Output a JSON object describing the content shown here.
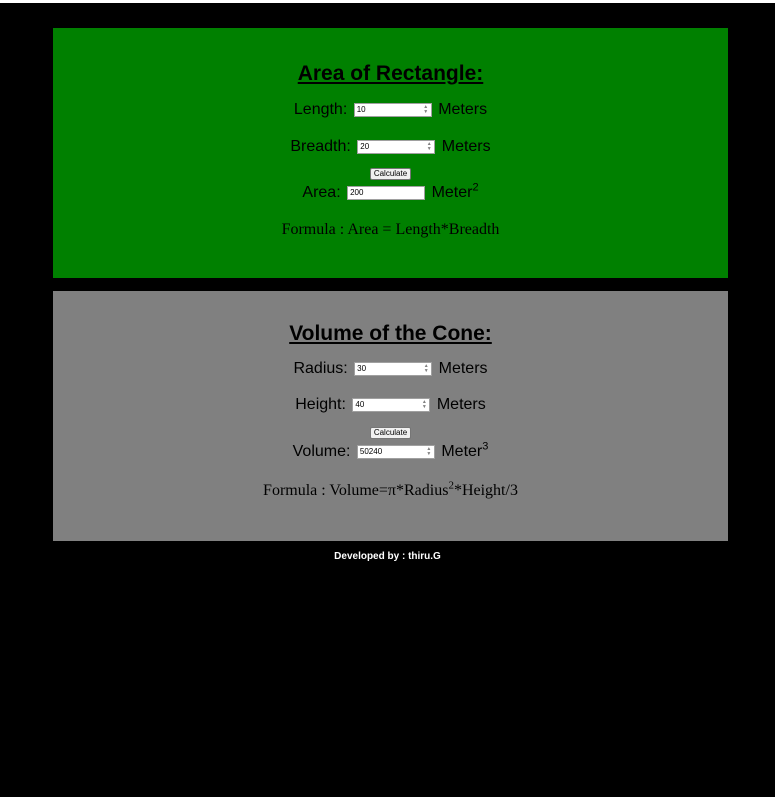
{
  "rectangle": {
    "title": "Area of Rectangle:",
    "length_label": "Length:",
    "length_value": "10",
    "length_unit": "Meters",
    "breadth_label": "Breadth:",
    "breadth_value": "20",
    "breadth_unit": "Meters",
    "calculate_label": "Calculate",
    "area_label": "Area:",
    "area_value": "200",
    "area_unit": "Meter",
    "area_unit_exp": "2",
    "formula": "Formula : Area = Length*Breadth"
  },
  "cone": {
    "title": "Volume of the Cone:",
    "radius_label": "Radius:",
    "radius_value": "30",
    "radius_unit": "Meters",
    "height_label": "Height:",
    "height_value": "40",
    "height_unit": "Meters",
    "calculate_label": "Calculate",
    "volume_label": "Volume:",
    "volume_value": "50240",
    "volume_unit": "Meter",
    "volume_unit_exp": "3",
    "formula_prefix": "Formula : Volume=π*Radius",
    "formula_exp": "2",
    "formula_suffix": "*Height/3"
  },
  "footer": {
    "text": "Developed by : thiru.G"
  },
  "colors": {
    "background": "#000000",
    "rectangle_panel": "#008000",
    "cone_panel": "#808080",
    "footer_text": "#ffffff"
  }
}
